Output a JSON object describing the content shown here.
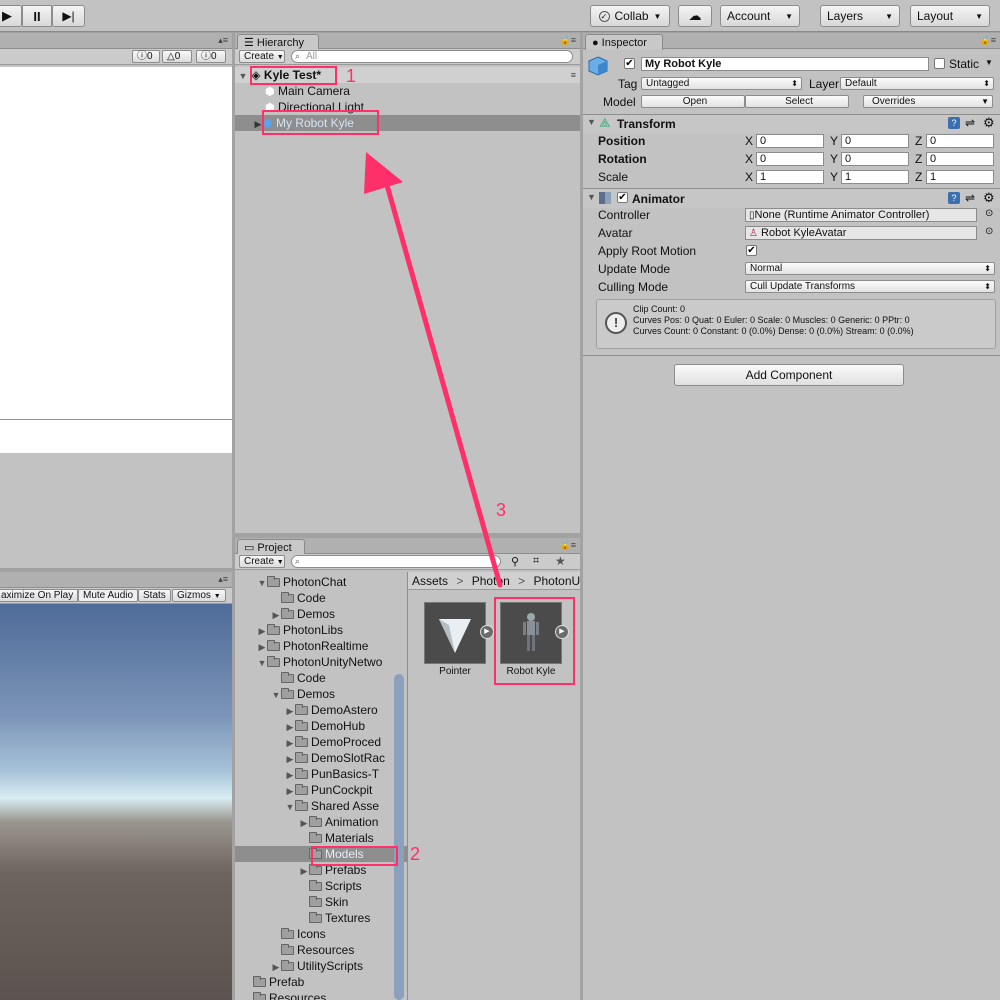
{
  "toolbar": {
    "collab": "Collab",
    "account": "Account",
    "layers": "Layers",
    "layout": "Layout"
  },
  "scene_panel": {
    "counts": [
      "0",
      "0",
      "0"
    ]
  },
  "game_panel": {
    "buttons": [
      "aximize On Play",
      "Mute Audio",
      "Stats",
      "Gizmos"
    ]
  },
  "hierarchy": {
    "tab": "Hierarchy",
    "create": "Create",
    "search_placeholder": "All",
    "scene": "Kyle Test*",
    "items": [
      "Main Camera",
      "Directional Light",
      "My Robot Kyle"
    ]
  },
  "project": {
    "tab": "Project",
    "create": "Create",
    "breadcrumb": [
      "Assets",
      "Photon",
      "PhotonUn"
    ],
    "tree": [
      {
        "label": "PhotonChat",
        "indent": 1,
        "arrow": "open"
      },
      {
        "label": "Code",
        "indent": 2,
        "arrow": "none"
      },
      {
        "label": "Demos",
        "indent": 2,
        "arrow": "closed"
      },
      {
        "label": "PhotonLibs",
        "indent": 1,
        "arrow": "closed"
      },
      {
        "label": "PhotonRealtime",
        "indent": 1,
        "arrow": "closed"
      },
      {
        "label": "PhotonUnityNetwo",
        "indent": 1,
        "arrow": "open"
      },
      {
        "label": "Code",
        "indent": 2,
        "arrow": "none"
      },
      {
        "label": "Demos",
        "indent": 2,
        "arrow": "open"
      },
      {
        "label": "DemoAstero",
        "indent": 3,
        "arrow": "closed"
      },
      {
        "label": "DemoHub",
        "indent": 3,
        "arrow": "closed"
      },
      {
        "label": "DemoProced",
        "indent": 3,
        "arrow": "closed"
      },
      {
        "label": "DemoSlotRac",
        "indent": 3,
        "arrow": "closed"
      },
      {
        "label": "PunBasics-T",
        "indent": 3,
        "arrow": "closed"
      },
      {
        "label": "PunCockpit",
        "indent": 3,
        "arrow": "closed"
      },
      {
        "label": "Shared Asse",
        "indent": 3,
        "arrow": "open"
      },
      {
        "label": "Animation",
        "indent": 4,
        "arrow": "closed"
      },
      {
        "label": "Materials",
        "indent": 4,
        "arrow": "none"
      },
      {
        "label": "Models",
        "indent": 4,
        "arrow": "none"
      },
      {
        "label": "Prefabs",
        "indent": 4,
        "arrow": "closed"
      },
      {
        "label": "Scripts",
        "indent": 4,
        "arrow": "none"
      },
      {
        "label": "Skin",
        "indent": 4,
        "arrow": "none"
      },
      {
        "label": "Textures",
        "indent": 4,
        "arrow": "none"
      },
      {
        "label": "Icons",
        "indent": 2,
        "arrow": "none"
      },
      {
        "label": "Resources",
        "indent": 2,
        "arrow": "none"
      },
      {
        "label": "UtilityScripts",
        "indent": 2,
        "arrow": "closed"
      },
      {
        "label": "Prefab",
        "indent": 0,
        "arrow": "none"
      },
      {
        "label": "Resources",
        "indent": 0,
        "arrow": "none"
      }
    ],
    "assets": [
      {
        "label": "Pointer"
      },
      {
        "label": "Robot Kyle"
      }
    ]
  },
  "inspector": {
    "tab": "Inspector",
    "object_name": "My Robot Kyle",
    "static": "Static",
    "tag_label": "Tag",
    "tag": "Untagged",
    "layer_label": "Layer",
    "layer": "Default",
    "model_label": "Model",
    "open": "Open",
    "select": "Select",
    "overrides": "Overrides",
    "transform": {
      "title": "Transform",
      "position": "Position",
      "rotation": "Rotation",
      "scale": "Scale",
      "pos": [
        "0",
        "0",
        "0"
      ],
      "rot": [
        "0",
        "0",
        "0"
      ],
      "scl": [
        "1",
        "1",
        "1"
      ],
      "axes": [
        "X",
        "Y",
        "Z"
      ]
    },
    "animator": {
      "title": "Animator",
      "controller_label": "Controller",
      "controller": "None (Runtime Animator Controller)",
      "avatar_label": "Avatar",
      "avatar": "Robot KyleAvatar",
      "apply_root_motion": "Apply Root Motion",
      "update_mode_label": "Update Mode",
      "update_mode": "Normal",
      "culling_mode_label": "Culling Mode",
      "culling_mode": "Cull Update Transforms",
      "info": [
        "Clip Count: 0",
        "Curves Pos: 0 Quat: 0 Euler: 0 Scale: 0 Muscles: 0 Generic: 0 PPtr: 0",
        "Curves Count: 0 Constant: 0 (0.0%) Dense: 0 (0.0%) Stream: 0 (0.0%)"
      ]
    },
    "add_component": "Add Component"
  },
  "annotations": [
    "1",
    "2",
    "3"
  ],
  "colors": {
    "highlight": "#ff2f6a",
    "selection_row": "#8e8e8e"
  }
}
